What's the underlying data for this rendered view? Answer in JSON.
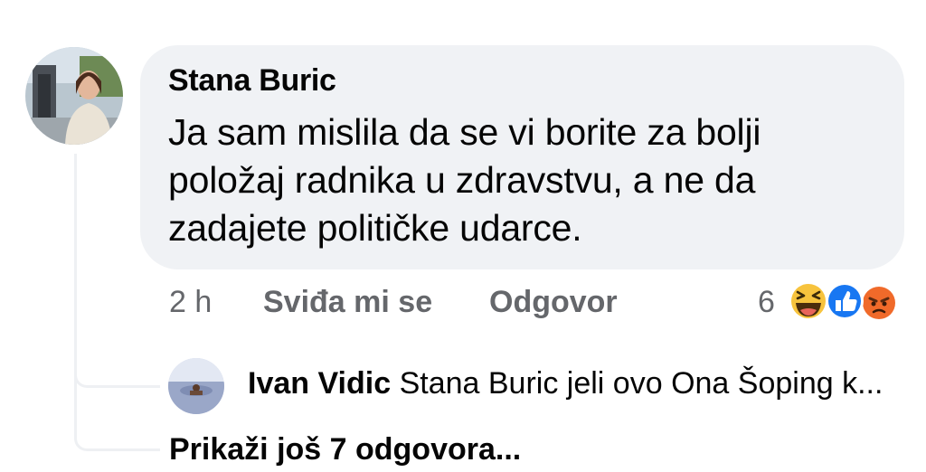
{
  "comment": {
    "author": "Stana Buric",
    "text": "Ja sam mislila da se vi borite za bolji položaj radnika u zdravstvu, a ne da zadajete političke udarce.",
    "time": "2 h",
    "like_label": "Sviđa mi se",
    "reply_label": "Odgovor",
    "reaction_count": "6",
    "reactions": [
      "haha-icon",
      "like-icon",
      "angry-icon"
    ]
  },
  "reply": {
    "author": "Ivan Vidic",
    "text": "Stana Buric jeli ovo Ona Šoping k..."
  },
  "show_more_label": "Prikaži još 7 odgovora...",
  "colors": {
    "bubble": "#f0f2f5",
    "text": "#050505",
    "meta": "#65676b",
    "like_blue": "#1877f2",
    "haha_yellow": "#f7c33d",
    "angry_orange": "#f06a2a"
  }
}
